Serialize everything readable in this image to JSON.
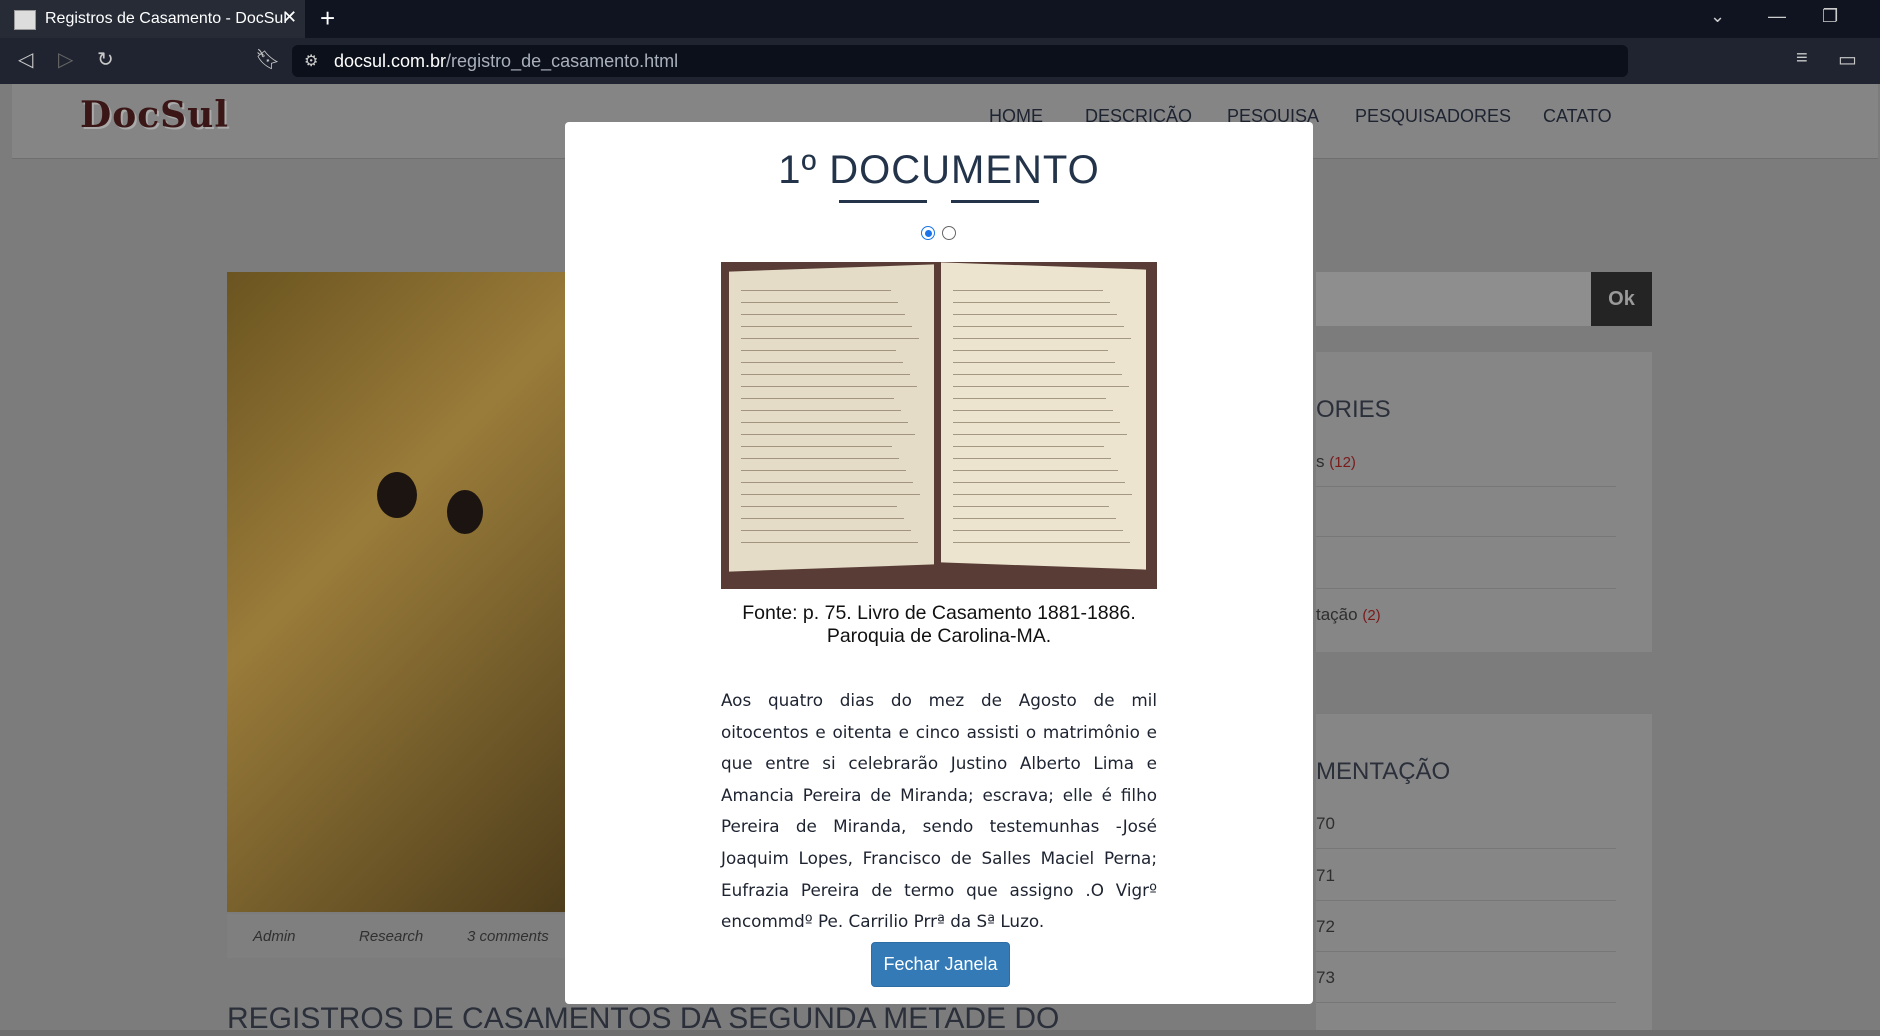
{
  "browser": {
    "tab_title": "Registros de Casamento - DocSul",
    "tab_close": "✕",
    "new_tab": "+",
    "url_domain": "docsul.com.br",
    "url_path": "/registro_de_casamento.html"
  },
  "site": {
    "logo": "DocSul",
    "nav": [
      "HOME",
      "DESCRIÇÃO",
      "PESQUISA",
      "PESQUISADORES",
      "CATATO"
    ],
    "search_button": "Ok",
    "post_meta": {
      "author": "Admin",
      "category": "Research",
      "comments": "3 comments"
    },
    "post_title": "REGISTROS DE CASAMENTOS DA SEGUNDA METADE DO",
    "sidebar": {
      "categories_heading_partial": "ORIES",
      "category_items": [
        {
          "label": "s",
          "count": "(12)"
        },
        {
          "label": "",
          "count": ""
        },
        {
          "label": "",
          "count": ""
        },
        {
          "label": "tação",
          "count": "(2)"
        }
      ],
      "doc_heading_partial": "MENTAÇÃO",
      "doc_items": [
        "70",
        "71",
        "72",
        "73"
      ]
    }
  },
  "modal": {
    "title": "1º DOCUMENTO",
    "slides": {
      "count": 2,
      "active": 1
    },
    "caption_line1": "Fonte: p. 75. Livro de Casamento 1881-1886.",
    "caption_line2": "Paroquia de Carolina-MA.",
    "body": "Aos quatro dias do mez de Agosto de mil oitocentos e oitenta e cinco assisti o matrimônio e que entre si celebrarão Justino Alberto Lima e Amancia Pereira de Miranda; escrava; elle é filho Pereira de Miranda, sendo testemunhas -José Joaquim Lopes, Francisco de Salles Maciel Perna; Eufrazia Pereira de termo que assigno .O Vigrº encommdº Pe. Carrilio Prrª da Sª Luzo.",
    "close_button": "Fechar Janela"
  }
}
